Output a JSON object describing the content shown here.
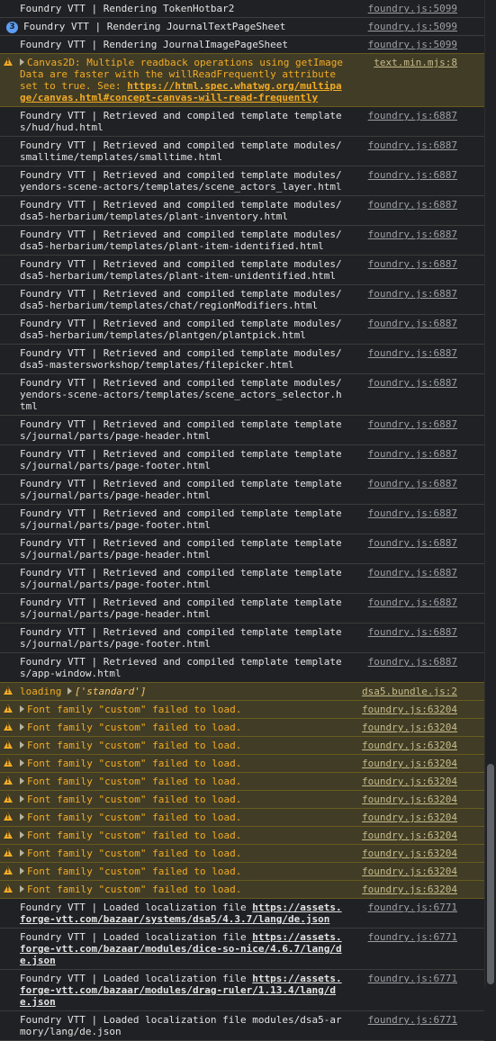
{
  "rows": [
    {
      "kind": "log",
      "text": "Foundry VTT | Rendering TokenHotbar2",
      "source": "foundry.js:5099"
    },
    {
      "kind": "log",
      "badge": "3",
      "text": "Foundry VTT | Rendering JournalTextPageSheet",
      "source": "foundry.js:5099"
    },
    {
      "kind": "log",
      "text": "Foundry VTT | Rendering JournalImagePageSheet",
      "source": "foundry.js:5099"
    },
    {
      "kind": "canvas-warn",
      "text_pre": "Canvas2D: Multiple readback operations using getImageData are faster with the willReadFrequently attribute set to true. See: ",
      "link": "https://html.spec.whatwg.org/multipage/canvas.html#concept-canvas-will-read-frequently",
      "source": "text.min.mjs:8"
    },
    {
      "kind": "log",
      "text": "Foundry VTT | Retrieved and compiled template templates/hud/hud.html",
      "source": "foundry.js:6887"
    },
    {
      "kind": "log",
      "text": "Foundry VTT | Retrieved and compiled template modules/smalltime/templates/smalltime.html",
      "source": "foundry.js:6887"
    },
    {
      "kind": "log",
      "text": "Foundry VTT | Retrieved and compiled template modules/yendors-scene-actors/templates/scene_actors_layer.html",
      "source": "foundry.js:6887"
    },
    {
      "kind": "log",
      "text": "Foundry VTT | Retrieved and compiled template modules/dsa5-herbarium/templates/plant-inventory.html",
      "source": "foundry.js:6887"
    },
    {
      "kind": "log",
      "text": "Foundry VTT | Retrieved and compiled template modules/dsa5-herbarium/templates/plant-item-identified.html",
      "source": "foundry.js:6887"
    },
    {
      "kind": "log",
      "text": "Foundry VTT | Retrieved and compiled template modules/dsa5-herbarium/templates/plant-item-unidentified.html",
      "source": "foundry.js:6887"
    },
    {
      "kind": "log",
      "text": "Foundry VTT | Retrieved and compiled template modules/dsa5-herbarium/templates/chat/regionModifiers.html",
      "source": "foundry.js:6887"
    },
    {
      "kind": "log",
      "text": "Foundry VTT | Retrieved and compiled template modules/dsa5-herbarium/templates/plantgen/plantpick.html",
      "source": "foundry.js:6887"
    },
    {
      "kind": "log",
      "text": "Foundry VTT | Retrieved and compiled template modules/dsa5-mastersworkshop/templates/filepicker.html",
      "source": "foundry.js:6887"
    },
    {
      "kind": "log",
      "text": "Foundry VTT | Retrieved and compiled template modules/yendors-scene-actors/templates/scene_actors_selector.html",
      "source": "foundry.js:6887"
    },
    {
      "kind": "log",
      "text": "Foundry VTT | Retrieved and compiled template templates/journal/parts/page-header.html",
      "source": "foundry.js:6887"
    },
    {
      "kind": "log",
      "text": "Foundry VTT | Retrieved and compiled template templates/journal/parts/page-footer.html",
      "source": "foundry.js:6887"
    },
    {
      "kind": "log",
      "text": "Foundry VTT | Retrieved and compiled template templates/journal/parts/page-header.html",
      "source": "foundry.js:6887"
    },
    {
      "kind": "log",
      "text": "Foundry VTT | Retrieved and compiled template templates/journal/parts/page-footer.html",
      "source": "foundry.js:6887"
    },
    {
      "kind": "log",
      "text": "Foundry VTT | Retrieved and compiled template templates/journal/parts/page-header.html",
      "source": "foundry.js:6887"
    },
    {
      "kind": "log",
      "text": "Foundry VTT | Retrieved and compiled template templates/journal/parts/page-footer.html",
      "source": "foundry.js:6887"
    },
    {
      "kind": "log",
      "text": "Foundry VTT | Retrieved and compiled template templates/journal/parts/page-header.html",
      "source": "foundry.js:6887"
    },
    {
      "kind": "log",
      "text": "Foundry VTT | Retrieved and compiled template templates/journal/parts/page-footer.html",
      "source": "foundry.js:6887"
    },
    {
      "kind": "log",
      "text": "Foundry VTT | Retrieved and compiled template templates/app-window.html",
      "source": "foundry.js:6887"
    },
    {
      "kind": "loading-warn",
      "label": "loading",
      "value": "['standard']",
      "source": "dsa5.bundle.js:2"
    },
    {
      "kind": "font-warn",
      "text": "Font family \"custom\" failed to load.",
      "source": "foundry.js:63204"
    },
    {
      "kind": "font-warn",
      "text": "Font family \"custom\" failed to load.",
      "source": "foundry.js:63204"
    },
    {
      "kind": "font-warn",
      "text": "Font family \"custom\" failed to load.",
      "source": "foundry.js:63204"
    },
    {
      "kind": "font-warn",
      "text": "Font family \"custom\" failed to load.",
      "source": "foundry.js:63204"
    },
    {
      "kind": "font-warn",
      "text": "Font family \"custom\" failed to load.",
      "source": "foundry.js:63204"
    },
    {
      "kind": "font-warn",
      "text": "Font family \"custom\" failed to load.",
      "source": "foundry.js:63204"
    },
    {
      "kind": "font-warn",
      "text": "Font family \"custom\" failed to load.",
      "source": "foundry.js:63204"
    },
    {
      "kind": "font-warn",
      "text": "Font family \"custom\" failed to load.",
      "source": "foundry.js:63204"
    },
    {
      "kind": "font-warn",
      "text": "Font family \"custom\" failed to load.",
      "source": "foundry.js:63204"
    },
    {
      "kind": "font-warn",
      "text": "Font family \"custom\" failed to load.",
      "source": "foundry.js:63204"
    },
    {
      "kind": "font-warn",
      "text": "Font family \"custom\" failed to load.",
      "source": "foundry.js:63204"
    },
    {
      "kind": "loc",
      "text_pre": "Foundry VTT | Loaded localization file ",
      "link": "https://assets.forge-vtt.com/bazaar/systems/dsa5/4.3.7/lang/de.json",
      "source": "foundry.js:6771"
    },
    {
      "kind": "loc",
      "text_pre": "Foundry VTT | Loaded localization file ",
      "link": "https://assets.forge-vtt.com/bazaar/modules/dice-so-nice/4.6.7/lang/de.json",
      "source": "foundry.js:6771"
    },
    {
      "kind": "loc",
      "text_pre": "Foundry VTT | Loaded localization file ",
      "link": "https://assets.forge-vtt.com/bazaar/modules/drag-ruler/1.13.4/lang/de.json",
      "source": "foundry.js:6771"
    },
    {
      "kind": "log",
      "text": "Foundry VTT | Loaded localization file modules/dsa5-armory/lang/de.json",
      "source": "foundry.js:6771"
    }
  ]
}
